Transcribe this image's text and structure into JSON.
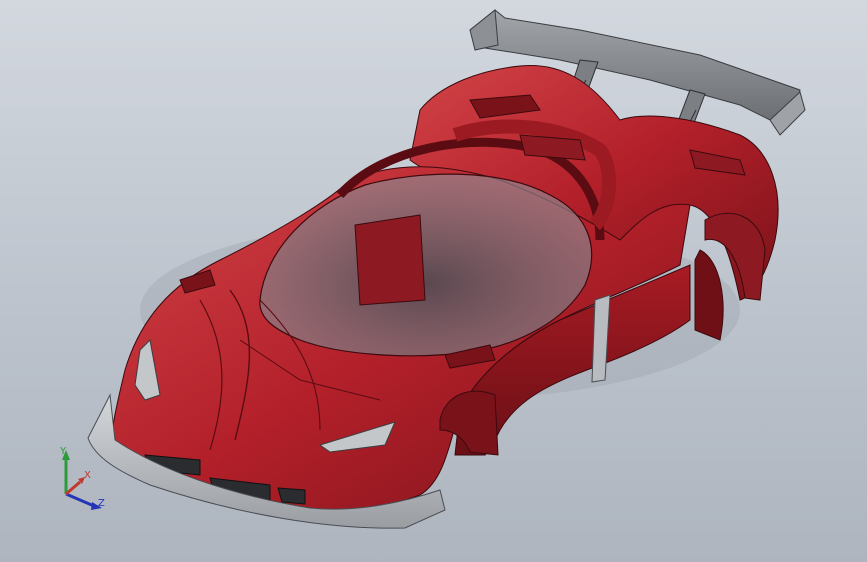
{
  "viewport": {
    "background_top": "#d3d8df",
    "background_bottom": "#aeb5bf"
  },
  "model": {
    "body_color": "#b3202a",
    "body_shadow": "#6e1016",
    "body_highlight": "#d84a50",
    "trim_color": "#b8bcc0",
    "wing_color": "#8a8d92"
  },
  "triad": {
    "x_label": "X",
    "y_label": "Y",
    "z_label": "Z",
    "x_color": "#c0392b",
    "y_color": "#2e9a3c",
    "z_color": "#2535b8"
  }
}
